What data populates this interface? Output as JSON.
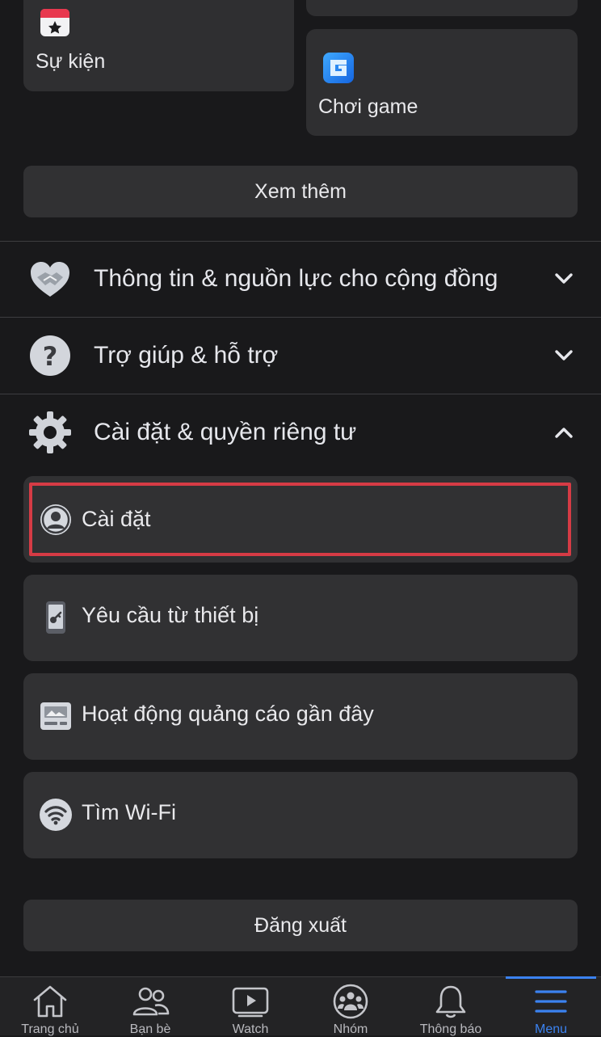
{
  "shortcuts": {
    "events_label": "Sự kiện",
    "gaming_label": "Chơi game"
  },
  "see_more_label": "Xem thêm",
  "sections": [
    {
      "label": "Thông tin & nguồn lực cho cộng đồng",
      "icon": "handshake-heart-icon",
      "expanded": false
    },
    {
      "label": "Trợ giúp & hỗ trợ",
      "icon": "question-icon",
      "expanded": false
    },
    {
      "label": "Cài đặt & quyền riêng tư",
      "icon": "gear-icon",
      "expanded": true
    }
  ],
  "settings_items": [
    {
      "label": "Cài đặt",
      "icon": "user-circle-icon",
      "highlighted": true
    },
    {
      "label": "Yêu cầu từ thiết bị",
      "icon": "phone-key-icon"
    },
    {
      "label": "Hoạt động quảng cáo gần đây",
      "icon": "ad-image-icon"
    },
    {
      "label": "Tìm Wi-Fi",
      "icon": "wifi-icon"
    }
  ],
  "logout_label": "Đăng xuất",
  "tabs": [
    {
      "label": "Trang chủ",
      "icon": "home-icon"
    },
    {
      "label": "Bạn bè",
      "icon": "friends-icon"
    },
    {
      "label": "Watch",
      "icon": "watch-play-icon"
    },
    {
      "label": "Nhóm",
      "icon": "groups-icon"
    },
    {
      "label": "Thông báo",
      "icon": "bell-icon"
    },
    {
      "label": "Menu",
      "icon": "menu-icon",
      "active": true
    }
  ],
  "colors": {
    "background": "#19191b",
    "card": "#313133",
    "accent": "#3b82f0",
    "highlight": "#d63b45"
  }
}
